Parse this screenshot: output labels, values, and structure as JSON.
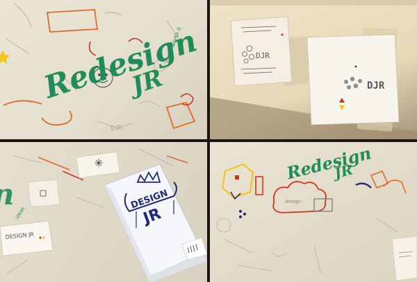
{
  "panels": {
    "top_left": {
      "logo_word": "Redesign",
      "logo_suffix": "JR",
      "small_note": "ideas worth it"
    },
    "top_right": {
      "card_left_logo": "DJR",
      "card_right_logo": "DJR"
    },
    "bottom_left": {
      "folder_word": "DESIGN",
      "folder_suffix": "JR",
      "small_card_label": "DESIGN JR"
    },
    "bottom_right": {
      "logo_word": "Redesign",
      "logo_suffix": "JR"
    }
  },
  "colors": {
    "green": "#1f8c5a",
    "navy": "#1f2a78",
    "orange": "#e06a2a",
    "red": "#d0361f",
    "yellow": "#f2c41c",
    "pencil": "#8a8478"
  }
}
